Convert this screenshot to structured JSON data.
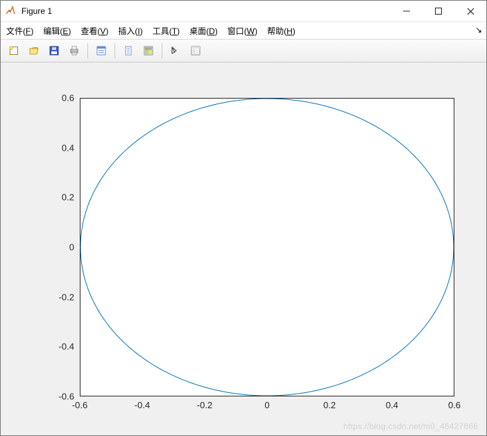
{
  "window": {
    "title": "Figure 1"
  },
  "menu": {
    "items": [
      {
        "label": "文件",
        "key": "F"
      },
      {
        "label": "编辑",
        "key": "E"
      },
      {
        "label": "查看",
        "key": "V"
      },
      {
        "label": "插入",
        "key": "I"
      },
      {
        "label": "工具",
        "key": "T"
      },
      {
        "label": "桌面",
        "key": "D"
      },
      {
        "label": "窗口",
        "key": "W"
      },
      {
        "label": "帮助",
        "key": "H"
      }
    ],
    "dock_arrow": "↘"
  },
  "toolbar": {
    "icons": [
      "new-figure-icon",
      "open-icon",
      "save-icon",
      "print-icon",
      "sep",
      "print-preview-icon",
      "sep",
      "data-cursor-icon",
      "colorbar-icon",
      "sep",
      "edit-plot-icon",
      "property-inspector-icon"
    ]
  },
  "chart_data": {
    "type": "line",
    "title": "",
    "xlabel": "",
    "ylabel": "",
    "xlim": [
      -0.6,
      0.6
    ],
    "ylim": [
      -0.6,
      0.6
    ],
    "xticks": [
      -0.6,
      -0.4,
      -0.2,
      0,
      0.2,
      0.4,
      0.6
    ],
    "yticks": [
      -0.6,
      -0.4,
      -0.2,
      0,
      0.2,
      0.4,
      0.6
    ],
    "series": [
      {
        "name": "ellipse",
        "color": "#0072bd",
        "curve": "parametric-ellipse",
        "rx": 0.6,
        "ry": 0.6,
        "cx": 0.0,
        "cy": 0.0,
        "note": "circle of radius 0.6 in data units; appears elliptical due to unequal axis pixel scaling"
      }
    ]
  },
  "watermark": "https://blog.csdn.net/m0_46427866"
}
